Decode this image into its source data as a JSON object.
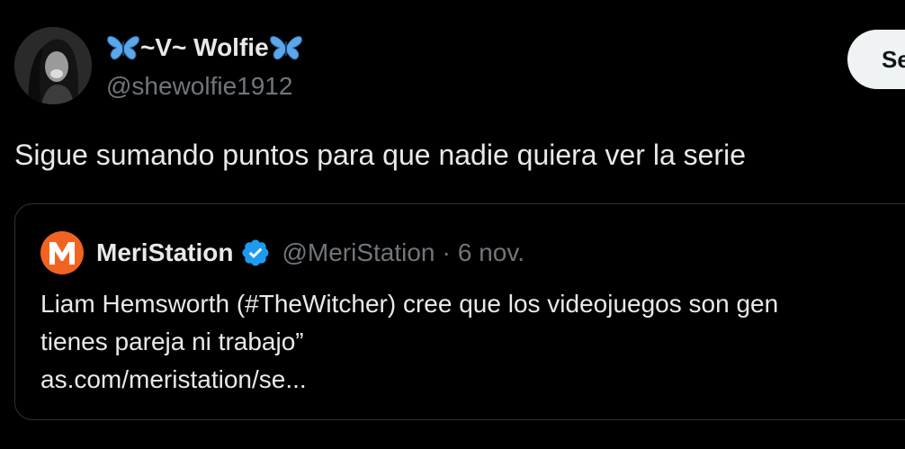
{
  "author": {
    "display_name": "~V~ Wolfie",
    "handle": "@shewolfie1912"
  },
  "action_button": {
    "label": "See"
  },
  "tweet": {
    "text": "Sigue sumando puntos para que nadie quiera ver la serie"
  },
  "quoted_tweet": {
    "author_name": "MeriStation",
    "author_handle": "@MeriStation",
    "separator": "·",
    "date": "6 nov.",
    "text_line_1": "Liam Hemsworth (#TheWitcher) cree que los videojuegos son gen",
    "text_line_2": "tienes pareja ni trabajo”",
    "link": "as.com/meristation/se..."
  },
  "colors": {
    "background": "#000000",
    "text_primary": "#e7e9ea",
    "text_secondary": "#71767b",
    "verified_blue": "#1d9bf0",
    "butterfly_blue": "#5ba7e8",
    "meristation_orange": "#f26322",
    "button_bg": "#eff3f4"
  },
  "icons": {
    "avatar": "user-avatar-photo",
    "butterfly": "butterfly-emoji",
    "verified": "verified-badge-icon",
    "quote_avatar": "meristation-logo"
  }
}
